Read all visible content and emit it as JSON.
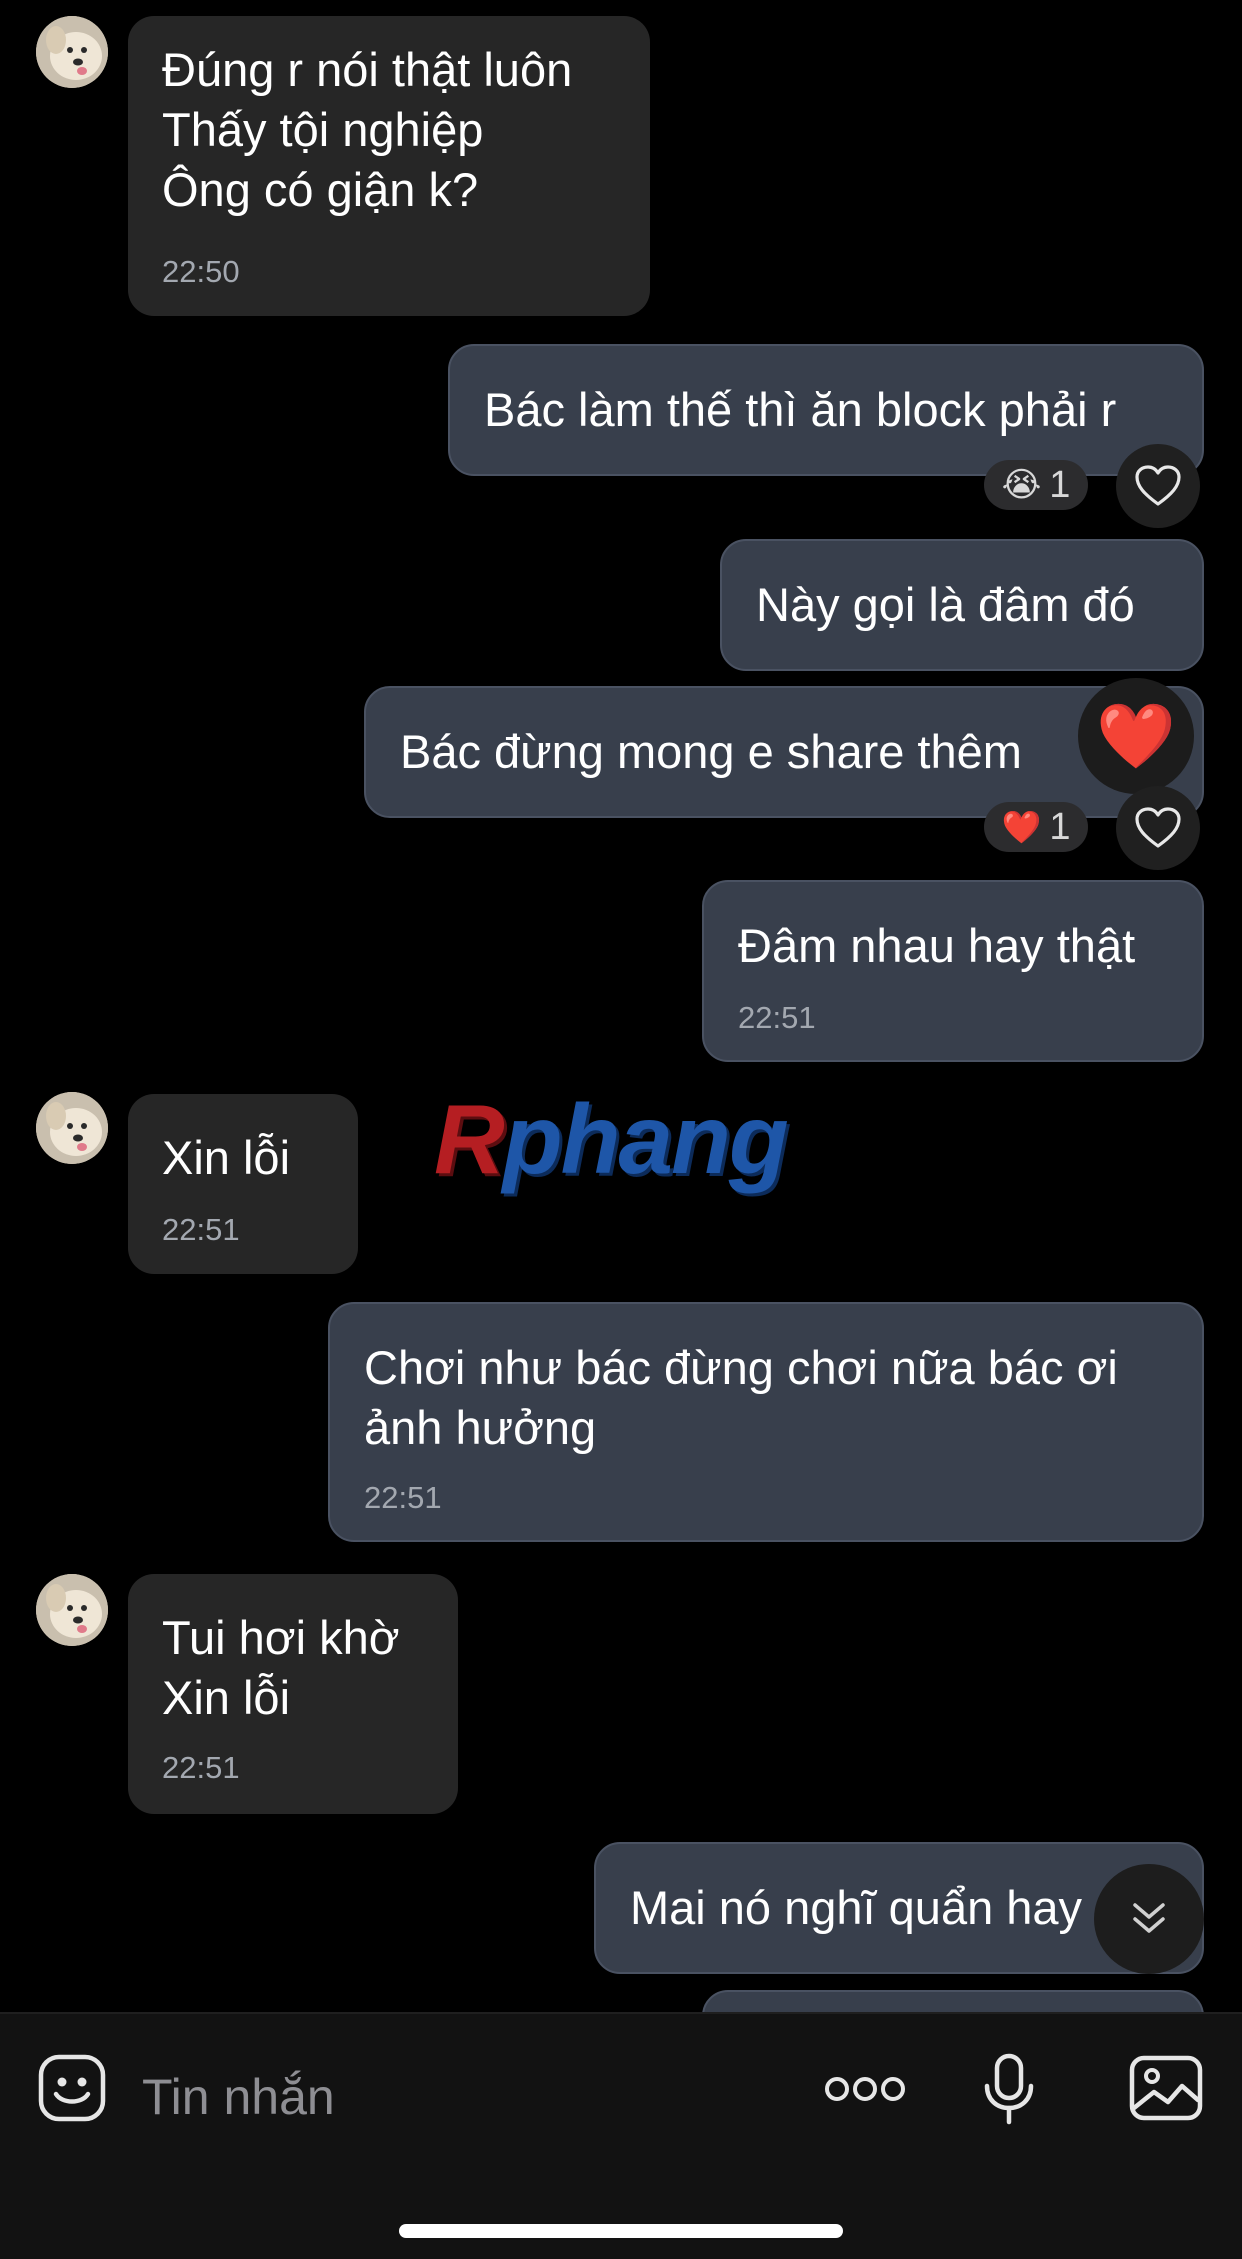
{
  "messages": {
    "m1": {
      "lines": "Đúng r nói thật luôn\nThấy tội nghiệp\nÔng có giận k?",
      "time": "22:50"
    },
    "m2": {
      "text": "Bác làm thế thì ăn block phải r",
      "reaction_emoji": "😭",
      "reaction_count": "1"
    },
    "m3": {
      "text": "Này gọi là đâm đó"
    },
    "m4": {
      "text": "Bác đừng mong e share thêm",
      "reaction_emoji": "❤️",
      "reaction_count": "1",
      "overlay_emoji": "❤️"
    },
    "m5": {
      "text": "Đâm nhau hay thật",
      "time": "22:51"
    },
    "m6": {
      "text": "Xin lỗi",
      "time": "22:51"
    },
    "m7": {
      "lines": "Chơi như bác đừng chơi nữa bác ơi\nảnh hưởng",
      "time": "22:51"
    },
    "m8": {
      "lines": "Tui hơi khờ\nXin lỗi",
      "time": "22:51"
    },
    "m9": {
      "text": "Mai nó nghĩ quẩn hay"
    }
  },
  "watermark": {
    "first": "R",
    "rest": "phang"
  },
  "input": {
    "placeholder": "Tin nhắn"
  },
  "icons": {
    "sticker": "sticker-icon",
    "more": "more-dots-icon",
    "mic": "microphone-icon",
    "image": "image-icon",
    "heart": "heart-outline-icon",
    "scroll": "double-chevron-down-icon"
  },
  "colors": {
    "background": "#000000",
    "incoming_bubble": "#262626",
    "outgoing_bubble": "#383f4c",
    "timestamp": "#a3a8b0"
  }
}
